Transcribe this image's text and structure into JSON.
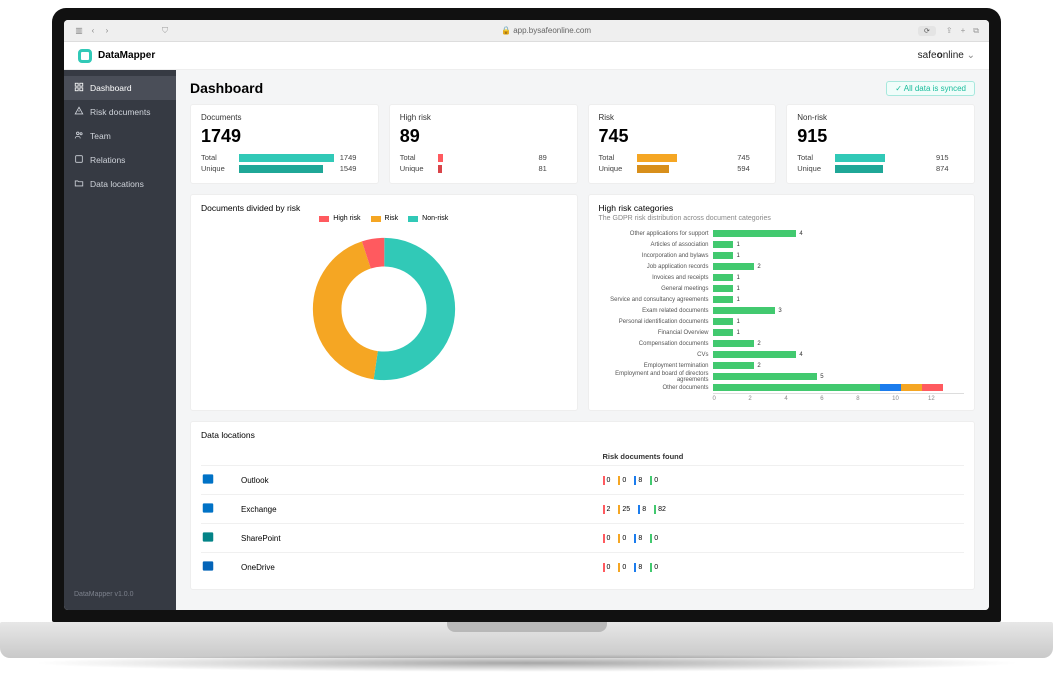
{
  "browser": {
    "url": "app.bysafeonline.com"
  },
  "brand": {
    "name": "DataMapper",
    "tenant": "safeonline"
  },
  "sidebar": {
    "items": [
      {
        "label": "Dashboard",
        "icon": "dashboard"
      },
      {
        "label": "Risk documents",
        "icon": "alert"
      },
      {
        "label": "Team",
        "icon": "users"
      },
      {
        "label": "Relations",
        "icon": "link"
      },
      {
        "label": "Data locations",
        "icon": "folder"
      }
    ],
    "footer": "DataMapper v1.0.0"
  },
  "page": {
    "title": "Dashboard",
    "sync_label": "All data is synced"
  },
  "colors": {
    "teal": "#31c9b7",
    "orange": "#f5a623",
    "red": "#ff5a5f",
    "green": "#42c96f",
    "blue": "#1b7ced",
    "yellow": "#f7c948"
  },
  "stats": [
    {
      "title": "Documents",
      "value": "1749",
      "rows": [
        {
          "lbl": "Total",
          "val": "1749",
          "pct": 100,
          "color": "#31c9b7"
        },
        {
          "lbl": "Unique",
          "val": "1549",
          "pct": 89,
          "color": "#1fa797"
        }
      ],
      "max": 1749
    },
    {
      "title": "High risk",
      "value": "89",
      "rows": [
        {
          "lbl": "Total",
          "val": "89",
          "pct": 6,
          "color": "#ff5a5f"
        },
        {
          "lbl": "Unique",
          "val": "81",
          "pct": 5,
          "color": "#d94449"
        }
      ],
      "max": 1749
    },
    {
      "title": "Risk",
      "value": "745",
      "rows": [
        {
          "lbl": "Total",
          "val": "745",
          "pct": 43,
          "color": "#f5a623"
        },
        {
          "lbl": "Unique",
          "val": "594",
          "pct": 34,
          "color": "#d88f1b"
        }
      ],
      "max": 1749
    },
    {
      "title": "Non-risk",
      "value": "915",
      "rows": [
        {
          "lbl": "Total",
          "val": "915",
          "pct": 52,
          "color": "#31c9b7"
        },
        {
          "lbl": "Unique",
          "val": "874",
          "pct": 50,
          "color": "#1fa797"
        }
      ],
      "max": 1749
    }
  ],
  "donut": {
    "title": "Documents divided by risk",
    "legend": [
      {
        "label": "High risk",
        "color": "#ff5a5f"
      },
      {
        "label": "Risk",
        "color": "#f5a623"
      },
      {
        "label": "Non-risk",
        "color": "#31c9b7"
      }
    ]
  },
  "high_risk_chart": {
    "title": "High risk categories",
    "subtitle": "The GDPR risk distribution across document categories"
  },
  "chart_data": [
    {
      "type": "pie",
      "title": "Documents divided by risk",
      "series": [
        {
          "name": "High risk",
          "value": 89,
          "color": "#ff5a5f",
          "pct": 5.1
        },
        {
          "name": "Risk",
          "value": 745,
          "color": "#f5a623",
          "pct": 42.6
        },
        {
          "name": "Non-risk",
          "value": 915,
          "color": "#31c9b7",
          "pct": 52.3
        }
      ]
    },
    {
      "type": "bar",
      "orientation": "horizontal",
      "title": "High risk categories",
      "xlabel": "",
      "ylabel": "",
      "xlim": [
        0,
        12
      ],
      "ticks": [
        0,
        2,
        4,
        6,
        8,
        10,
        12
      ],
      "categories": [
        "Other applications for support",
        "Articles of association",
        "Incorporation and bylaws",
        "Job application records",
        "Invoices and receipts",
        "General meetings",
        "Service and consultancy agreements",
        "Exam related documents",
        "Personal identification documents",
        "Financial Overview",
        "Compensation documents",
        "CVs",
        "Employment termination",
        "Employment and board of directors agreements",
        "Other documents"
      ],
      "values": [
        4,
        1,
        1,
        2,
        1,
        1,
        1,
        3,
        1,
        1,
        2,
        4,
        2,
        5,
        11
      ],
      "stacked_last": {
        "index": 14,
        "segments": [
          {
            "v": 8,
            "color": "#42c96f"
          },
          {
            "v": 1,
            "color": "#1b7ced"
          },
          {
            "v": 1,
            "color": "#f5a623"
          },
          {
            "v": 1,
            "color": "#ff5a5f"
          }
        ]
      }
    }
  ],
  "locations": {
    "title": "Data locations",
    "col2": "Risk documents found",
    "rows": [
      {
        "name": "Outlook",
        "color": "#0072c6",
        "risks": [
          {
            "c": "#ff5a5f",
            "n": 0
          },
          {
            "c": "#f5a623",
            "n": 0
          },
          {
            "c": "#1b7ced",
            "n": 8
          },
          {
            "c": "#42c96f",
            "n": 0
          }
        ]
      },
      {
        "name": "Exchange",
        "color": "#0072c6",
        "risks": [
          {
            "c": "#ff5a5f",
            "n": 2
          },
          {
            "c": "#f5a623",
            "n": 25
          },
          {
            "c": "#1b7ced",
            "n": 8
          },
          {
            "c": "#42c96f",
            "n": 82
          }
        ]
      },
      {
        "name": "SharePoint",
        "color": "#038387",
        "risks": [
          {
            "c": "#ff5a5f",
            "n": 0
          },
          {
            "c": "#f5a623",
            "n": 0
          },
          {
            "c": "#1b7ced",
            "n": 8
          },
          {
            "c": "#42c96f",
            "n": 0
          }
        ]
      },
      {
        "name": "OneDrive",
        "color": "#0364b8",
        "risks": [
          {
            "c": "#ff5a5f",
            "n": 0
          },
          {
            "c": "#f5a623",
            "n": 0
          },
          {
            "c": "#1b7ced",
            "n": 8
          },
          {
            "c": "#42c96f",
            "n": 0
          }
        ]
      }
    ]
  }
}
